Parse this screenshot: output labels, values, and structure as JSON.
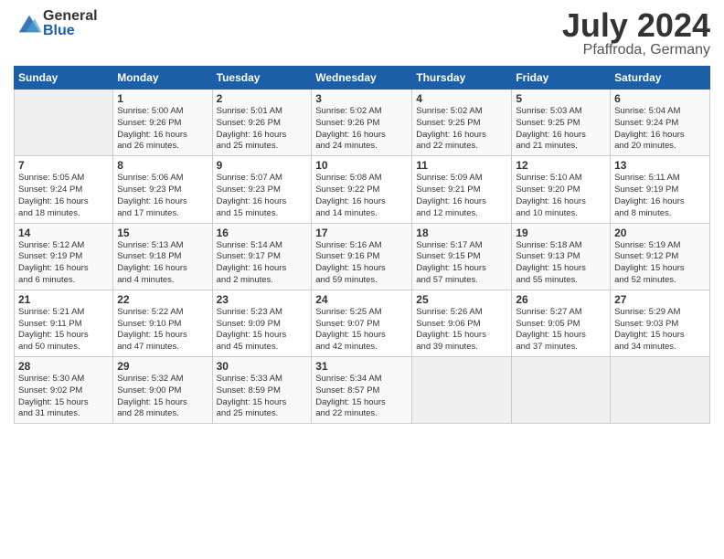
{
  "header": {
    "logo_general": "General",
    "logo_blue": "Blue",
    "month": "July 2024",
    "location": "Pfaffroda, Germany"
  },
  "weekdays": [
    "Sunday",
    "Monday",
    "Tuesday",
    "Wednesday",
    "Thursday",
    "Friday",
    "Saturday"
  ],
  "weeks": [
    [
      {
        "day": "",
        "info": ""
      },
      {
        "day": "1",
        "info": "Sunrise: 5:00 AM\nSunset: 9:26 PM\nDaylight: 16 hours\nand 26 minutes."
      },
      {
        "day": "2",
        "info": "Sunrise: 5:01 AM\nSunset: 9:26 PM\nDaylight: 16 hours\nand 25 minutes."
      },
      {
        "day": "3",
        "info": "Sunrise: 5:02 AM\nSunset: 9:26 PM\nDaylight: 16 hours\nand 24 minutes."
      },
      {
        "day": "4",
        "info": "Sunrise: 5:02 AM\nSunset: 9:25 PM\nDaylight: 16 hours\nand 22 minutes."
      },
      {
        "day": "5",
        "info": "Sunrise: 5:03 AM\nSunset: 9:25 PM\nDaylight: 16 hours\nand 21 minutes."
      },
      {
        "day": "6",
        "info": "Sunrise: 5:04 AM\nSunset: 9:24 PM\nDaylight: 16 hours\nand 20 minutes."
      }
    ],
    [
      {
        "day": "7",
        "info": "Sunrise: 5:05 AM\nSunset: 9:24 PM\nDaylight: 16 hours\nand 18 minutes."
      },
      {
        "day": "8",
        "info": "Sunrise: 5:06 AM\nSunset: 9:23 PM\nDaylight: 16 hours\nand 17 minutes."
      },
      {
        "day": "9",
        "info": "Sunrise: 5:07 AM\nSunset: 9:23 PM\nDaylight: 16 hours\nand 15 minutes."
      },
      {
        "day": "10",
        "info": "Sunrise: 5:08 AM\nSunset: 9:22 PM\nDaylight: 16 hours\nand 14 minutes."
      },
      {
        "day": "11",
        "info": "Sunrise: 5:09 AM\nSunset: 9:21 PM\nDaylight: 16 hours\nand 12 minutes."
      },
      {
        "day": "12",
        "info": "Sunrise: 5:10 AM\nSunset: 9:20 PM\nDaylight: 16 hours\nand 10 minutes."
      },
      {
        "day": "13",
        "info": "Sunrise: 5:11 AM\nSunset: 9:19 PM\nDaylight: 16 hours\nand 8 minutes."
      }
    ],
    [
      {
        "day": "14",
        "info": "Sunrise: 5:12 AM\nSunset: 9:19 PM\nDaylight: 16 hours\nand 6 minutes."
      },
      {
        "day": "15",
        "info": "Sunrise: 5:13 AM\nSunset: 9:18 PM\nDaylight: 16 hours\nand 4 minutes."
      },
      {
        "day": "16",
        "info": "Sunrise: 5:14 AM\nSunset: 9:17 PM\nDaylight: 16 hours\nand 2 minutes."
      },
      {
        "day": "17",
        "info": "Sunrise: 5:16 AM\nSunset: 9:16 PM\nDaylight: 15 hours\nand 59 minutes."
      },
      {
        "day": "18",
        "info": "Sunrise: 5:17 AM\nSunset: 9:15 PM\nDaylight: 15 hours\nand 57 minutes."
      },
      {
        "day": "19",
        "info": "Sunrise: 5:18 AM\nSunset: 9:13 PM\nDaylight: 15 hours\nand 55 minutes."
      },
      {
        "day": "20",
        "info": "Sunrise: 5:19 AM\nSunset: 9:12 PM\nDaylight: 15 hours\nand 52 minutes."
      }
    ],
    [
      {
        "day": "21",
        "info": "Sunrise: 5:21 AM\nSunset: 9:11 PM\nDaylight: 15 hours\nand 50 minutes."
      },
      {
        "day": "22",
        "info": "Sunrise: 5:22 AM\nSunset: 9:10 PM\nDaylight: 15 hours\nand 47 minutes."
      },
      {
        "day": "23",
        "info": "Sunrise: 5:23 AM\nSunset: 9:09 PM\nDaylight: 15 hours\nand 45 minutes."
      },
      {
        "day": "24",
        "info": "Sunrise: 5:25 AM\nSunset: 9:07 PM\nDaylight: 15 hours\nand 42 minutes."
      },
      {
        "day": "25",
        "info": "Sunrise: 5:26 AM\nSunset: 9:06 PM\nDaylight: 15 hours\nand 39 minutes."
      },
      {
        "day": "26",
        "info": "Sunrise: 5:27 AM\nSunset: 9:05 PM\nDaylight: 15 hours\nand 37 minutes."
      },
      {
        "day": "27",
        "info": "Sunrise: 5:29 AM\nSunset: 9:03 PM\nDaylight: 15 hours\nand 34 minutes."
      }
    ],
    [
      {
        "day": "28",
        "info": "Sunrise: 5:30 AM\nSunset: 9:02 PM\nDaylight: 15 hours\nand 31 minutes."
      },
      {
        "day": "29",
        "info": "Sunrise: 5:32 AM\nSunset: 9:00 PM\nDaylight: 15 hours\nand 28 minutes."
      },
      {
        "day": "30",
        "info": "Sunrise: 5:33 AM\nSunset: 8:59 PM\nDaylight: 15 hours\nand 25 minutes."
      },
      {
        "day": "31",
        "info": "Sunrise: 5:34 AM\nSunset: 8:57 PM\nDaylight: 15 hours\nand 22 minutes."
      },
      {
        "day": "",
        "info": ""
      },
      {
        "day": "",
        "info": ""
      },
      {
        "day": "",
        "info": ""
      }
    ]
  ]
}
